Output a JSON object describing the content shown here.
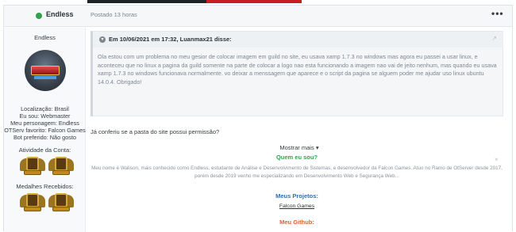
{
  "post": {
    "author": "Endless",
    "posted": "Postado 13 horas",
    "options_icon": "more-dots-icon"
  },
  "sidebar": {
    "name": "Endless",
    "fields": [
      "Localização: Brasil",
      "Eu sou: Webmaster",
      "Meu personagem: Endless",
      "OTServ favorito: Falcon Games",
      "Bot preferido: Não gosto"
    ],
    "activity_heading": "Atividade da Conta:",
    "medals_heading": "Medalhes Recebidos:"
  },
  "quote": {
    "title": "Em 10/06/2021 em 17:32, Luanmax21 disse:",
    "body": "Ola estou com um problema no meu gesior de colocar imagem em guild no site, eu usava xamp 1.7.3 no windows mas agora eu passei a usar linux, e aconteceu que no linux a pagina da guild somente na parte de colocar a logo nao esta funcionando a imagem nao vai de jeito nenhum, mas quando eu usava  xamp 1.7.3 no windows funcionava normalmente. vo deixar a menssagem que aparece e o script da pagina se alguem poder me ajudar uso linux ubuntu 14.0.4. Obrigado!"
  },
  "show_more": "Mostrar mais",
  "reply": "Já conferiu se a pasta do site possui permissão?",
  "signature": {
    "heading1": "Quem eu sou?",
    "bio": "Meu nome é Walison, mais conhecido como Endless, estudante de Análise e Desenvolvimento de Sistemas, e desenvolvedor da Falcon Games. Atuo no Ramo de OtServer desde 2017, porém desde 2019 venho me especializando em Desenvolvimento Web e Segurança Web...",
    "heading2": "Meus Projetos:",
    "project": "Falcon Games",
    "heading3": "Meu Github:"
  },
  "colors": {
    "online": "#2fa34a",
    "heading1": "#2fa34a",
    "heading2": "#2a6fb5",
    "heading3": "#d9622b"
  }
}
